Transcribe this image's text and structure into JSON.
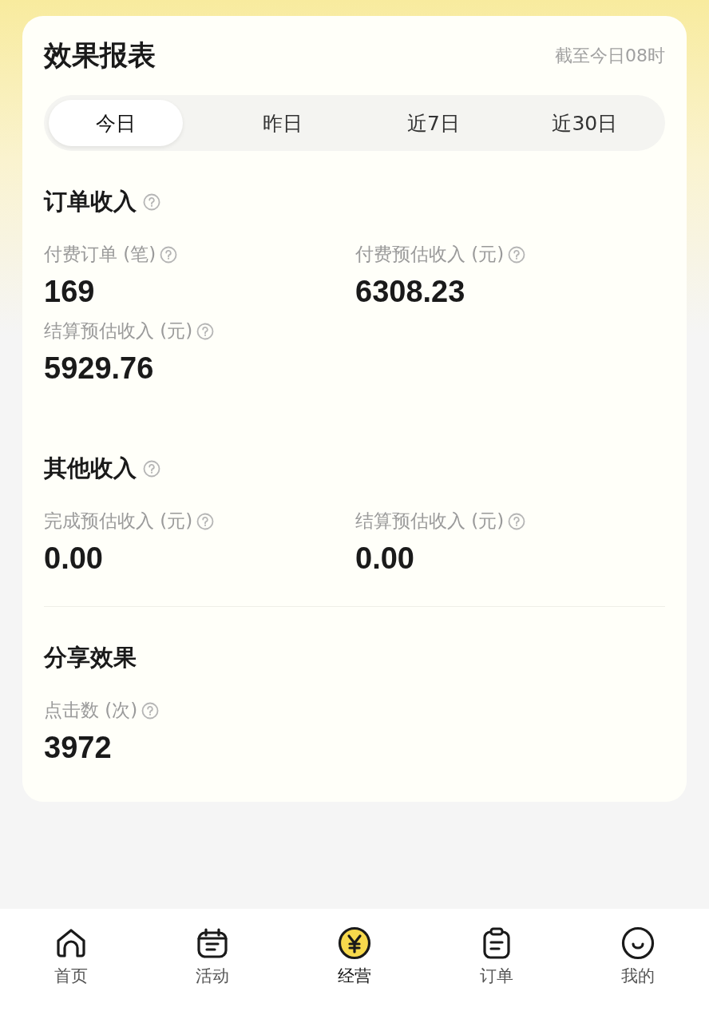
{
  "report": {
    "title": "效果报表",
    "updated": "截至今日08时"
  },
  "tabs": [
    {
      "label": "今日",
      "selected": true
    },
    {
      "label": "昨日",
      "selected": false
    },
    {
      "label": "近7日",
      "selected": false
    },
    {
      "label": "近30日",
      "selected": false
    }
  ],
  "sections": [
    {
      "title": "订单收入",
      "help": true,
      "divider": false,
      "metrics": [
        {
          "label": "付费订单 (笔)",
          "value": "169"
        },
        {
          "label": "付费预估收入 (元)",
          "value": "6308.23"
        },
        {
          "label": "结算预估收入 (元)",
          "value": "5929.76"
        }
      ]
    },
    {
      "title": "其他收入",
      "help": true,
      "divider": true,
      "metrics": [
        {
          "label": "完成预估收入 (元)",
          "value": "0.00"
        },
        {
          "label": "结算预估收入 (元)",
          "value": "0.00"
        }
      ]
    },
    {
      "title": "分享效果",
      "help": false,
      "divider": false,
      "metrics": [
        {
          "label": "点击数 (次)",
          "value": "3972"
        }
      ]
    }
  ],
  "nav": [
    {
      "kind": "home",
      "label": "首页",
      "selected": false
    },
    {
      "kind": "calendar",
      "label": "活动",
      "selected": false
    },
    {
      "kind": "yen",
      "label": "经营",
      "selected": true
    },
    {
      "kind": "clipboard",
      "label": "订单",
      "selected": false
    },
    {
      "kind": "smile",
      "label": "我的",
      "selected": false
    }
  ]
}
